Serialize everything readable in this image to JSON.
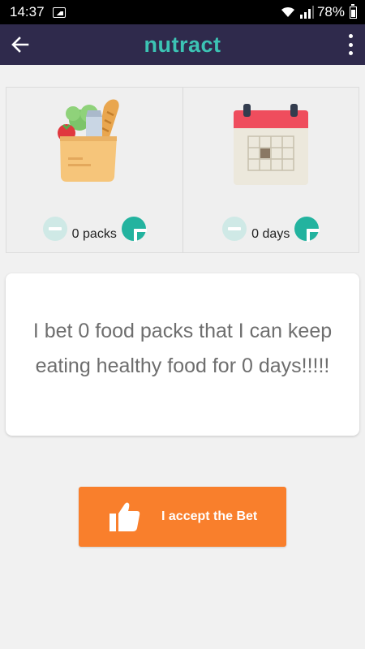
{
  "status_bar": {
    "time": "14:37",
    "battery": "78%"
  },
  "app_bar": {
    "title": "nutract"
  },
  "selectors": {
    "packs": {
      "value_text": "0 packs"
    },
    "days": {
      "value_text": "0 days"
    }
  },
  "bet": {
    "text": "I bet 0 food packs that I can keep eating healthy food for 0 days!!!!!"
  },
  "accept": {
    "label": "I accept the Bet"
  },
  "colors": {
    "app_bar": "#2f2a4c",
    "logo": "#3cc3b4",
    "accent_teal": "#23b39f",
    "accept_orange": "#f97f2c"
  },
  "icons": [
    "image-icon",
    "wifi-icon",
    "signal-icon",
    "battery-icon",
    "back-arrow-icon",
    "overflow-menu-icon",
    "grocery-bag-icon",
    "calendar-icon",
    "minus-icon",
    "plus-icon",
    "thumbs-up-icon"
  ]
}
